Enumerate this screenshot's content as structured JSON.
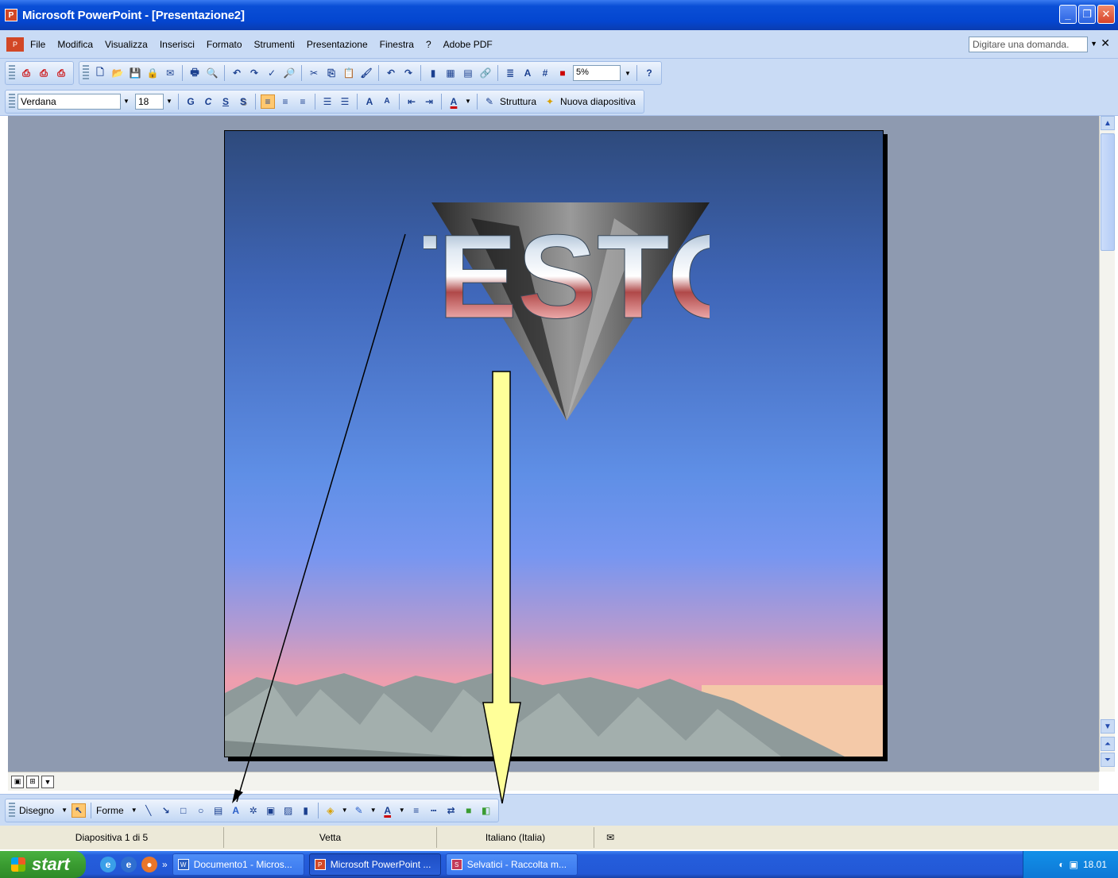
{
  "window": {
    "title": "Microsoft PowerPoint - [Presentazione2]"
  },
  "menu": {
    "items": [
      "File",
      "Modifica",
      "Visualizza",
      "Inserisci",
      "Formato",
      "Strumenti",
      "Presentazione",
      "Finestra",
      "?",
      "Adobe PDF"
    ],
    "help_placeholder": "Digitare una domanda."
  },
  "standard_toolbar": {
    "zoom": "5%"
  },
  "formatting_toolbar": {
    "font": "Verdana",
    "size": "18",
    "bold": "G",
    "italic": "C",
    "underline": "S",
    "shadow": "S",
    "struttura_label": "Struttura",
    "new_slide_label": "Nuova diapositiva"
  },
  "slide": {
    "wordart_text": "TESTO"
  },
  "drawing_toolbar": {
    "draw_label": "Disegno",
    "shapes_label": "Forme"
  },
  "status": {
    "slide_info": "Diapositiva 1 di 5",
    "design": "Vetta",
    "language": "Italiano (Italia)"
  },
  "taskbar": {
    "start_label": "start",
    "tasks": [
      "Documento1 - Micros...",
      "Microsoft PowerPoint ...",
      "Selvatici - Raccolta m..."
    ],
    "clock": "18.01"
  },
  "colors": {
    "title_bar": "#0446d0",
    "toolbar_bg": "#c9dbf5",
    "arrow_fill": "#ffff99"
  }
}
